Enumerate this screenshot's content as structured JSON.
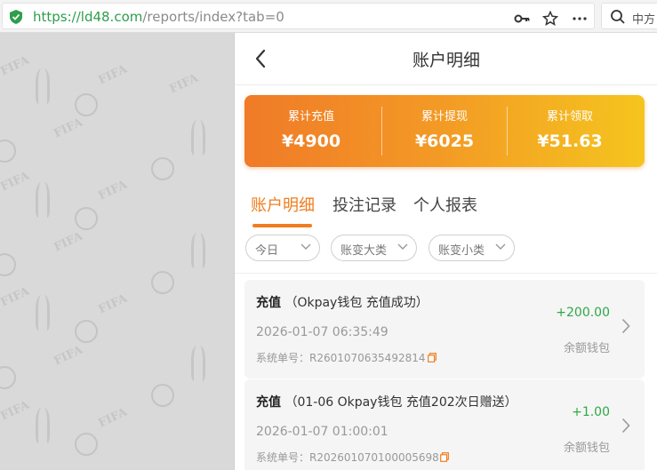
{
  "browser": {
    "url_scheme": "https://",
    "url_host": "ld48.com",
    "url_path": "/reports/index?tab=0",
    "search_placeholder": "中方"
  },
  "header": {
    "title": "账户明细"
  },
  "summary": {
    "items": [
      {
        "label": "累计充值",
        "value": "¥4900"
      },
      {
        "label": "累计提现",
        "value": "¥6025"
      },
      {
        "label": "累计领取",
        "value": "¥51.63"
      }
    ]
  },
  "tabs": [
    {
      "label": "账户明细",
      "active": true
    },
    {
      "label": "投注记录",
      "active": false
    },
    {
      "label": "个人报表",
      "active": false
    }
  ],
  "filters": [
    {
      "label": "今日"
    },
    {
      "label": "账变大类"
    },
    {
      "label": "账变小类"
    }
  ],
  "records": [
    {
      "type": "充值",
      "detail": "（Okpay钱包 充值成功）",
      "time": "2026-01-07 06:35:49",
      "order": "系统单号：R2601070635492814",
      "amount": "+200.00",
      "wallet": "余额钱包"
    },
    {
      "type": "充值",
      "detail": "（01-06 Okpay钱包 充值202次日赠送）",
      "time": "2026-01-07 01:00:01",
      "order": "系统单号：R202601070100005698",
      "amount": "+1.00",
      "wallet": "余额钱包"
    }
  ],
  "background": {
    "pattern_text": "FIFA"
  },
  "colors": {
    "accent": "#f07d1e",
    "positive_amount": "#2daa44",
    "gradient_start": "#f07a28",
    "gradient_end": "#f5c51e"
  },
  "icons": [
    "shield-icon",
    "key-icon",
    "star-icon",
    "more-icon",
    "search-icon",
    "back-arrow-icon",
    "chevron-down-icon",
    "copy-icon",
    "chevron-right-icon"
  ]
}
